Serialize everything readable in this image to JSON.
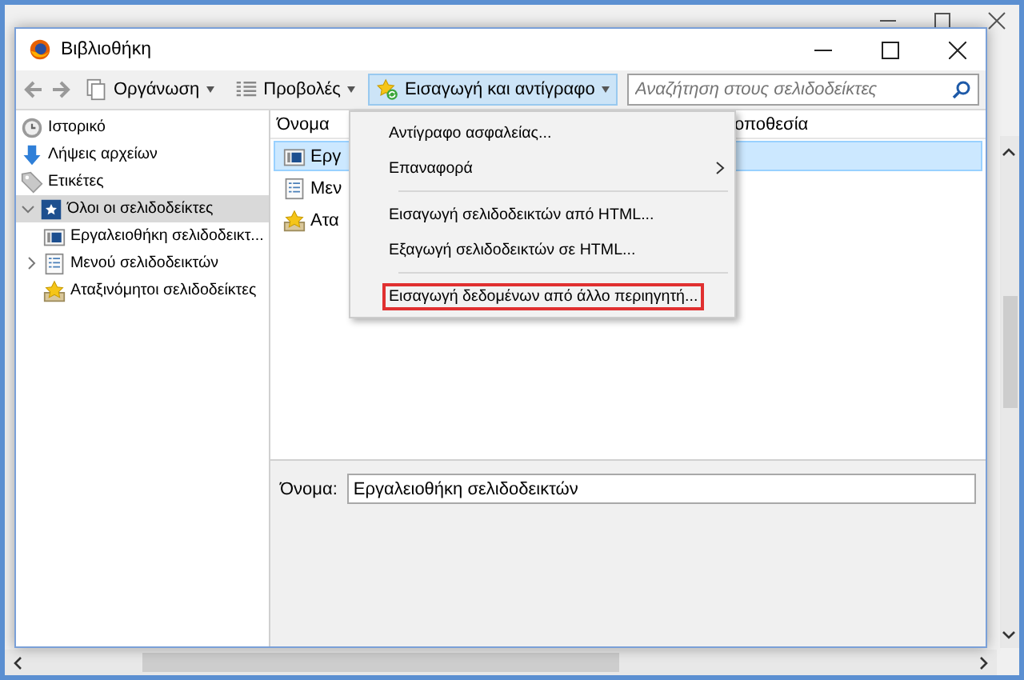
{
  "window": {
    "title": "Βιβλιοθήκη"
  },
  "toolbar": {
    "buttons": [
      {
        "label": "Οργάνωση",
        "kind": "organize",
        "selected": false
      },
      {
        "label": "Προβολές",
        "kind": "views",
        "selected": false
      },
      {
        "label": "Εισαγωγή και αντίγραφο",
        "kind": "import",
        "selected": true
      }
    ],
    "search": {
      "placeholder": "Αναζήτηση στους σελιδοδείκτες"
    }
  },
  "sidebar": {
    "items": [
      {
        "label": "Ιστορικό",
        "kind": "history",
        "selected": false
      },
      {
        "label": "Λήψεις αρχείων",
        "kind": "downloads",
        "selected": false
      },
      {
        "label": "Ετικέτες",
        "kind": "tags",
        "selected": false
      },
      {
        "label": "Όλοι οι σελιδοδείκτες",
        "kind": "all",
        "selected": true,
        "expanded": true,
        "children": [
          {
            "label": "Εργαλειοθήκη σελιδοδεικτ...",
            "kind": "toolbar",
            "selected": false
          },
          {
            "label": "Μενού σελιδοδεικτών",
            "kind": "menu",
            "selected": false,
            "expanded": false
          },
          {
            "label": "Αταξινόμητοι σελιδοδείκτες",
            "kind": "unsorted",
            "selected": false
          }
        ]
      }
    ]
  },
  "table": {
    "columns": [
      "Όνομα",
      "οποθεσία"
    ],
    "rows": [
      {
        "name": "Εργ",
        "kind": "toolbar",
        "selected": true
      },
      {
        "name": "Μεν",
        "kind": "menu",
        "selected": false
      },
      {
        "name": "Ατα",
        "kind": "unsorted",
        "selected": false
      }
    ]
  },
  "menu": {
    "items": [
      {
        "kind": "item",
        "label": "Αντίγραφο ασφαλείας...",
        "submenu": false,
        "highlighted": false
      },
      {
        "kind": "item",
        "label": "Επαναφορά",
        "submenu": true,
        "highlighted": false
      },
      {
        "kind": "separator"
      },
      {
        "kind": "item",
        "label": "Εισαγωγή σελιδοδεικτών από HTML...",
        "submenu": false,
        "highlighted": false
      },
      {
        "kind": "item",
        "label": "Εξαγωγή σελιδοδεικτών σε HTML...",
        "submenu": false,
        "highlighted": false
      },
      {
        "kind": "separator"
      },
      {
        "kind": "item",
        "label": "Εισαγωγή δεδομένων από άλλο περιηγητή...",
        "submenu": false,
        "highlighted": true
      }
    ]
  },
  "details": {
    "label": "Όνομα:",
    "value": "Εργαλειοθήκη σελιδοδεικτών"
  }
}
